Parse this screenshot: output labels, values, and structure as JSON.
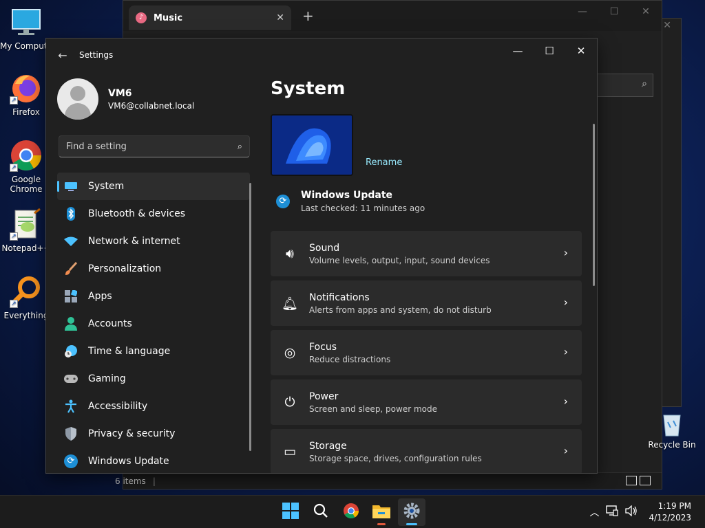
{
  "desktop": {
    "icons": [
      {
        "label": "My Computer"
      },
      {
        "label": "Firefox"
      },
      {
        "label": "Google Chrome"
      },
      {
        "label": "Notepad++"
      },
      {
        "label": "Everything"
      },
      {
        "label": "Recycle Bin"
      }
    ]
  },
  "music_window": {
    "tab_title": "Music",
    "new_tab": "+",
    "status_items": "6 items"
  },
  "settings": {
    "app_title": "Settings",
    "user": {
      "name": "VM6",
      "email": "VM6@collabnet.local"
    },
    "search_placeholder": "Find a setting",
    "nav": [
      {
        "label": "System",
        "icon": "monitor-icon",
        "active": true
      },
      {
        "label": "Bluetooth & devices",
        "icon": "bluetooth-icon"
      },
      {
        "label": "Network & internet",
        "icon": "wifi-icon"
      },
      {
        "label": "Personalization",
        "icon": "brush-icon"
      },
      {
        "label": "Apps",
        "icon": "apps-icon"
      },
      {
        "label": "Accounts",
        "icon": "person-icon"
      },
      {
        "label": "Time & language",
        "icon": "clock-globe-icon"
      },
      {
        "label": "Gaming",
        "icon": "gamepad-icon"
      },
      {
        "label": "Accessibility",
        "icon": "accessibility-icon"
      },
      {
        "label": "Privacy & security",
        "icon": "shield-icon"
      },
      {
        "label": "Windows Update",
        "icon": "refresh-icon"
      }
    ],
    "page_title": "System",
    "rename": "Rename",
    "update": {
      "title": "Windows Update",
      "subtitle": "Last checked: 11 minutes ago"
    },
    "cards": [
      {
        "title": "Sound",
        "subtitle": "Volume levels, output, input, sound devices",
        "icon": "speaker-icon"
      },
      {
        "title": "Notifications",
        "subtitle": "Alerts from apps and system, do not disturb",
        "icon": "bell-icon"
      },
      {
        "title": "Focus",
        "subtitle": "Reduce distractions",
        "icon": "focus-icon"
      },
      {
        "title": "Power",
        "subtitle": "Screen and sleep, power mode",
        "icon": "power-icon"
      },
      {
        "title": "Storage",
        "subtitle": "Storage space, drives, configuration rules",
        "icon": "storage-icon"
      }
    ]
  },
  "taskbar": {
    "time": "1:19 PM",
    "date": "4/12/2023"
  },
  "colors": {
    "accent": "#4cc2ff",
    "link": "#99ebff",
    "window_bg": "#202020",
    "card_bg": "#2b2b2b"
  }
}
